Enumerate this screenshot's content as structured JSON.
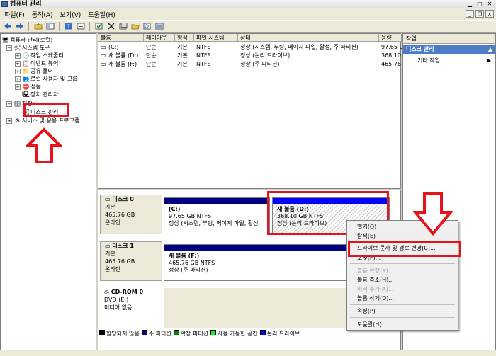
{
  "window": {
    "title": "컴퓨터 관리"
  },
  "menu": [
    "파일(F)",
    "동작(A)",
    "보기(V)",
    "도움말(H)"
  ],
  "toolbar": {
    "icons": [
      "back-arrow-icon",
      "forward-arrow-icon",
      "up-folder-icon",
      "show-hide-tree-icon",
      "help-icon",
      "properties-icon",
      "refresh-icon",
      "delete-icon",
      "properties-sheet-icon",
      "open-folder-icon",
      "search-icon",
      "export-icon"
    ]
  },
  "tree": {
    "root": "컴퓨터 관리(로컬)",
    "system_tools": "시스템 도구",
    "task_scheduler": "작업 스케줄러",
    "event_viewer": "이벤트 뷰어",
    "shared_folders": "공유 폴더",
    "local_users": "로컬 사용자 및 그룹",
    "performance": "성능",
    "device_manager": "장치 관리자",
    "storage": "저장소",
    "disk_management": "디스크 관리",
    "services": "서비스 및 응용 프로그램"
  },
  "list": {
    "columns": [
      "볼륨",
      "레이아웃",
      "형식",
      "파일 시스템",
      "상태",
      "용량"
    ],
    "rows": [
      [
        "(C:)",
        "단순",
        "기본",
        "NTFS",
        "정상 (시스템, 부팅, 페이지 파일, 활성, 주 파티션)",
        "97.65 G"
      ],
      [
        "새 볼륨 (D:)",
        "단순",
        "기본",
        "NTFS",
        "정상 (논리 드라이브)",
        "368.10"
      ],
      [
        "새 볼륨 (F:)",
        "단순",
        "기본",
        "NTFS",
        "정상 (주 파티션)",
        "465.76"
      ]
    ]
  },
  "actions": {
    "header": "작업",
    "selected": "디스크 관리",
    "item": "기타 작업"
  },
  "disks": [
    {
      "name": "디스크 0",
      "lines": [
        "기본",
        "465.76 GB",
        "온라인"
      ],
      "volumes": [
        {
          "title": "(C:)",
          "line1": "97.65 GB NTFS",
          "line2": "정상 (시스템, 부팅, 페이지 파일, 활성"
        },
        {
          "title": "새 볼륨  (D:)",
          "line1": "368.10 GB NTFS",
          "line2": "정상 (논리 드라이브)"
        }
      ]
    },
    {
      "name": "디스크 1",
      "lines": [
        "기본",
        "465.76 GB",
        "온라인"
      ],
      "volumes": [
        {
          "title": "새 볼륨  (F:)",
          "line1": "465.76 GB NTFS",
          "line2": "정상 (주 파티션)"
        }
      ]
    },
    {
      "name": "CD-ROM 0",
      "lines": [
        "DVD (E:)",
        "",
        "미디어 없음"
      ],
      "volumes": []
    }
  ],
  "legend": [
    {
      "label": "할당되지 않음",
      "color": "#000000"
    },
    {
      "label": "주 파티션",
      "color": "#000080"
    },
    {
      "label": "확장 파티션",
      "color": "#008000"
    },
    {
      "label": "사용 가능한 공간",
      "color": "#00ff00"
    },
    {
      "label": "논리 드라이브",
      "color": "#0000ff"
    }
  ],
  "context_menu": {
    "open": "열기(O)",
    "explore": "탐색(E)",
    "change_letter": "드라이브 문자 및 경로 변경(C)...",
    "format": "포맷(F)...",
    "extend": "볼륨 확장(X)...",
    "shrink": "볼륨 축소(H)...",
    "add_mirror": "미러 추가(A)...",
    "delete": "볼륨 삭제(D)...",
    "properties": "속성(P)",
    "help": "도움말(H)"
  },
  "colors": {
    "highlight_red": "#e8121c",
    "selection_blue": "#4d7cc7",
    "primary_partition": "#000080",
    "logical_drive": "#0000ff"
  }
}
